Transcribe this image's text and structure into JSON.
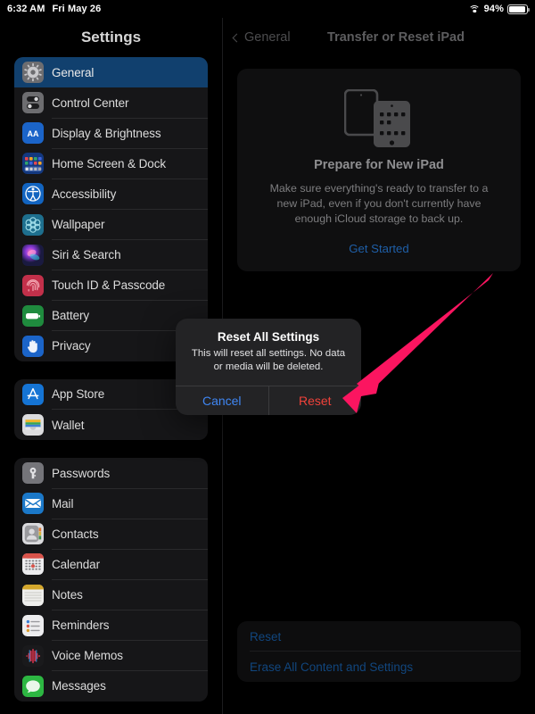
{
  "statusbar": {
    "time": "6:32 AM",
    "date": "Fri May 26",
    "wifi_icon": "wifi-icon",
    "battery_percent": "94%",
    "battery_icon": "battery-icon"
  },
  "sidebar": {
    "title": "Settings",
    "groups": [
      {
        "items": [
          {
            "label": "General",
            "icon": "gear-icon",
            "selected": true
          },
          {
            "label": "Control Center",
            "icon": "control-center-icon",
            "selected": false
          },
          {
            "label": "Display & Brightness",
            "icon": "display-brightness-icon",
            "selected": false
          },
          {
            "label": "Home Screen & Dock",
            "icon": "home-screen-dock-icon",
            "selected": false
          },
          {
            "label": "Accessibility",
            "icon": "accessibility-icon",
            "selected": false
          },
          {
            "label": "Wallpaper",
            "icon": "wallpaper-icon",
            "selected": false
          },
          {
            "label": "Siri & Search",
            "icon": "siri-icon",
            "selected": false
          },
          {
            "label": "Touch ID & Passcode",
            "icon": "touch-id-icon",
            "selected": false
          },
          {
            "label": "Battery",
            "icon": "battery-settings-icon",
            "selected": false
          },
          {
            "label": "Privacy",
            "icon": "privacy-hand-icon",
            "selected": false
          }
        ]
      },
      {
        "items": [
          {
            "label": "App Store",
            "icon": "app-store-icon",
            "selected": false
          },
          {
            "label": "Wallet",
            "icon": "wallet-icon",
            "selected": false
          }
        ]
      },
      {
        "items": [
          {
            "label": "Passwords",
            "icon": "passwords-key-icon",
            "selected": false
          },
          {
            "label": "Mail",
            "icon": "mail-icon",
            "selected": false
          },
          {
            "label": "Contacts",
            "icon": "contacts-icon",
            "selected": false
          },
          {
            "label": "Calendar",
            "icon": "calendar-icon",
            "selected": false
          },
          {
            "label": "Notes",
            "icon": "notes-icon",
            "selected": false
          },
          {
            "label": "Reminders",
            "icon": "reminders-icon",
            "selected": false
          },
          {
            "label": "Voice Memos",
            "icon": "voice-memos-icon",
            "selected": false
          },
          {
            "label": "Messages",
            "icon": "messages-icon",
            "selected": false
          }
        ]
      }
    ]
  },
  "nav": {
    "back_label": "General",
    "back_icon": "chevron-left-icon",
    "title": "Transfer or Reset iPad"
  },
  "prepare_card": {
    "art_icon": "two-ipads-icon",
    "title": "Prepare for New iPad",
    "body": "Make sure everything's ready to transfer to a new iPad, even if you don't currently have enough iCloud storage to back up.",
    "link": "Get Started"
  },
  "bottom_actions": [
    {
      "label": "Reset"
    },
    {
      "label": "Erase All Content and Settings"
    }
  ],
  "alert": {
    "title": "Reset All Settings",
    "message": "This will reset all settings. No data or media will be deleted.",
    "cancel_label": "Cancel",
    "confirm_label": "Reset"
  },
  "annotation": {
    "arrow_icon": "pink-pointer-arrow",
    "color": "#FB1560",
    "points_to": "Reset"
  },
  "colors": {
    "accent_blue": "#3f86f3",
    "destructive_red": "#f0423a",
    "selection_blue": "#11406e",
    "link_blue": "#1f5fa8",
    "annotation_pink": "#FB1560"
  }
}
